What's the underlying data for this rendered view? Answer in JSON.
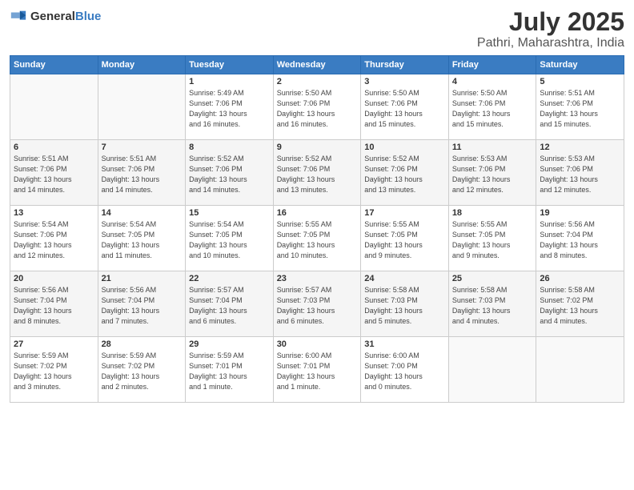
{
  "logo": {
    "general": "General",
    "blue": "Blue"
  },
  "header": {
    "month": "July 2025",
    "location": "Pathri, Maharashtra, India"
  },
  "weekdays": [
    "Sunday",
    "Monday",
    "Tuesday",
    "Wednesday",
    "Thursday",
    "Friday",
    "Saturday"
  ],
  "weeks": [
    [
      {
        "day": "",
        "detail": ""
      },
      {
        "day": "",
        "detail": ""
      },
      {
        "day": "1",
        "detail": "Sunrise: 5:49 AM\nSunset: 7:06 PM\nDaylight: 13 hours\nand 16 minutes."
      },
      {
        "day": "2",
        "detail": "Sunrise: 5:50 AM\nSunset: 7:06 PM\nDaylight: 13 hours\nand 16 minutes."
      },
      {
        "day": "3",
        "detail": "Sunrise: 5:50 AM\nSunset: 7:06 PM\nDaylight: 13 hours\nand 15 minutes."
      },
      {
        "day": "4",
        "detail": "Sunrise: 5:50 AM\nSunset: 7:06 PM\nDaylight: 13 hours\nand 15 minutes."
      },
      {
        "day": "5",
        "detail": "Sunrise: 5:51 AM\nSunset: 7:06 PM\nDaylight: 13 hours\nand 15 minutes."
      }
    ],
    [
      {
        "day": "6",
        "detail": "Sunrise: 5:51 AM\nSunset: 7:06 PM\nDaylight: 13 hours\nand 14 minutes."
      },
      {
        "day": "7",
        "detail": "Sunrise: 5:51 AM\nSunset: 7:06 PM\nDaylight: 13 hours\nand 14 minutes."
      },
      {
        "day": "8",
        "detail": "Sunrise: 5:52 AM\nSunset: 7:06 PM\nDaylight: 13 hours\nand 14 minutes."
      },
      {
        "day": "9",
        "detail": "Sunrise: 5:52 AM\nSunset: 7:06 PM\nDaylight: 13 hours\nand 13 minutes."
      },
      {
        "day": "10",
        "detail": "Sunrise: 5:52 AM\nSunset: 7:06 PM\nDaylight: 13 hours\nand 13 minutes."
      },
      {
        "day": "11",
        "detail": "Sunrise: 5:53 AM\nSunset: 7:06 PM\nDaylight: 13 hours\nand 12 minutes."
      },
      {
        "day": "12",
        "detail": "Sunrise: 5:53 AM\nSunset: 7:06 PM\nDaylight: 13 hours\nand 12 minutes."
      }
    ],
    [
      {
        "day": "13",
        "detail": "Sunrise: 5:54 AM\nSunset: 7:06 PM\nDaylight: 13 hours\nand 12 minutes."
      },
      {
        "day": "14",
        "detail": "Sunrise: 5:54 AM\nSunset: 7:05 PM\nDaylight: 13 hours\nand 11 minutes."
      },
      {
        "day": "15",
        "detail": "Sunrise: 5:54 AM\nSunset: 7:05 PM\nDaylight: 13 hours\nand 10 minutes."
      },
      {
        "day": "16",
        "detail": "Sunrise: 5:55 AM\nSunset: 7:05 PM\nDaylight: 13 hours\nand 10 minutes."
      },
      {
        "day": "17",
        "detail": "Sunrise: 5:55 AM\nSunset: 7:05 PM\nDaylight: 13 hours\nand 9 minutes."
      },
      {
        "day": "18",
        "detail": "Sunrise: 5:55 AM\nSunset: 7:05 PM\nDaylight: 13 hours\nand 9 minutes."
      },
      {
        "day": "19",
        "detail": "Sunrise: 5:56 AM\nSunset: 7:04 PM\nDaylight: 13 hours\nand 8 minutes."
      }
    ],
    [
      {
        "day": "20",
        "detail": "Sunrise: 5:56 AM\nSunset: 7:04 PM\nDaylight: 13 hours\nand 8 minutes."
      },
      {
        "day": "21",
        "detail": "Sunrise: 5:56 AM\nSunset: 7:04 PM\nDaylight: 13 hours\nand 7 minutes."
      },
      {
        "day": "22",
        "detail": "Sunrise: 5:57 AM\nSunset: 7:04 PM\nDaylight: 13 hours\nand 6 minutes."
      },
      {
        "day": "23",
        "detail": "Sunrise: 5:57 AM\nSunset: 7:03 PM\nDaylight: 13 hours\nand 6 minutes."
      },
      {
        "day": "24",
        "detail": "Sunrise: 5:58 AM\nSunset: 7:03 PM\nDaylight: 13 hours\nand 5 minutes."
      },
      {
        "day": "25",
        "detail": "Sunrise: 5:58 AM\nSunset: 7:03 PM\nDaylight: 13 hours\nand 4 minutes."
      },
      {
        "day": "26",
        "detail": "Sunrise: 5:58 AM\nSunset: 7:02 PM\nDaylight: 13 hours\nand 4 minutes."
      }
    ],
    [
      {
        "day": "27",
        "detail": "Sunrise: 5:59 AM\nSunset: 7:02 PM\nDaylight: 13 hours\nand 3 minutes."
      },
      {
        "day": "28",
        "detail": "Sunrise: 5:59 AM\nSunset: 7:02 PM\nDaylight: 13 hours\nand 2 minutes."
      },
      {
        "day": "29",
        "detail": "Sunrise: 5:59 AM\nSunset: 7:01 PM\nDaylight: 13 hours\nand 1 minute."
      },
      {
        "day": "30",
        "detail": "Sunrise: 6:00 AM\nSunset: 7:01 PM\nDaylight: 13 hours\nand 1 minute."
      },
      {
        "day": "31",
        "detail": "Sunrise: 6:00 AM\nSunset: 7:00 PM\nDaylight: 13 hours\nand 0 minutes."
      },
      {
        "day": "",
        "detail": ""
      },
      {
        "day": "",
        "detail": ""
      }
    ]
  ]
}
